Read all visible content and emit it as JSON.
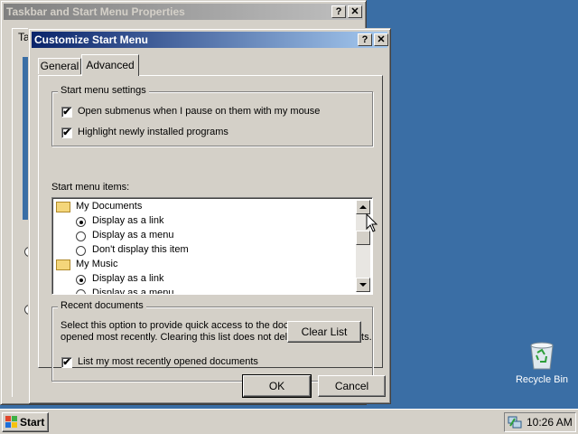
{
  "bg_window": {
    "title": "Taskbar and Start Menu Properties",
    "tab_partial": "Ta",
    "help_btn": "?",
    "close_btn": "✕"
  },
  "dialog": {
    "title": "Customize Start Menu",
    "help_btn": "?",
    "close_btn": "✕",
    "tabs": [
      "General",
      "Advanced"
    ],
    "start_menu_settings": {
      "legend": "Start menu settings",
      "options": [
        {
          "label": "Open submenus when I pause on them with my mouse",
          "checked": true
        },
        {
          "label": "Highlight newly installed programs",
          "checked": true
        }
      ]
    },
    "items_label": "Start menu items:",
    "items": [
      {
        "type": "folder",
        "label": "My Documents"
      },
      {
        "type": "radio",
        "label": "Display as a link",
        "selected": true
      },
      {
        "type": "radio",
        "label": "Display as a menu",
        "selected": false
      },
      {
        "type": "radio",
        "label": "Don't display this item",
        "selected": false
      },
      {
        "type": "folder",
        "label": "My Music"
      },
      {
        "type": "radio",
        "label": "Display as a link",
        "selected": true
      },
      {
        "type": "radio",
        "label": "Display as a menu",
        "selected": false
      }
    ],
    "recent": {
      "legend": "Recent documents",
      "description_line1": "Select this option to provide quick access to the documents you",
      "description_line2": "opened most recently.  Clearing this list does not delete the documents.",
      "checkbox_label": "List my most recently opened documents",
      "checked": true,
      "clear_button": "Clear List"
    },
    "ok": "OK",
    "cancel": "Cancel"
  },
  "desktop": {
    "recycle_bin": "Recycle Bin"
  },
  "taskbar": {
    "start": "Start",
    "clock": "10:26 AM"
  },
  "check_mark": "✔"
}
